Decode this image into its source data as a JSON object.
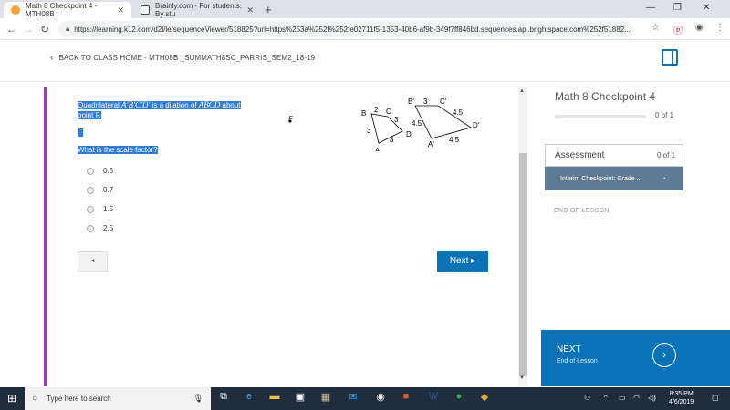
{
  "browser": {
    "tabs": [
      {
        "title": "Math 8 Checkpoint 4 - MTH08B",
        "active": true,
        "close": "✕"
      },
      {
        "title": "Brainly.com - For students. By stu",
        "active": false,
        "close": "✕"
      }
    ],
    "new_tab": "+",
    "url": "https://learning.k12.com/d2l/le/sequenceViewer/518825?url=https%253a%252f%252fe02711f5-1353-40b6-af9b-349f7ff846bd.sequences.api.brightspace.com%252f51882..."
  },
  "page_header": {
    "back_label": "BACK TO CLASS HOME - MTH08B _SUMMATH8SC_PARRIS_SEM2_18-19"
  },
  "question": {
    "line1_pre": "Quadrilateral ",
    "line1_math1": "A′B′C′D′",
    "line1_mid": " is a dilation of ",
    "line1_math2": "ABCD",
    "line1_post": " about",
    "line2": "point F.",
    "point_label": "F",
    "prompt": "What is the scale factor?",
    "options": [
      "0.5",
      "0.7",
      "1.5",
      "2.5"
    ]
  },
  "figure": {
    "small": {
      "vertices": [
        "B",
        "C",
        "D",
        "A"
      ],
      "sides": [
        "2",
        "3",
        "3",
        "3"
      ]
    },
    "large": {
      "vertices": [
        "B'",
        "C'",
        "D'",
        "A'"
      ],
      "sides": [
        "3",
        "4.5",
        "4.5",
        "4.5"
      ]
    }
  },
  "navigation": {
    "prev_label": "◂",
    "next_label": "Next ▸"
  },
  "sidebar": {
    "title": "Math 8 Checkpoint 4",
    "progress_fraction": 0,
    "progress_text": "0 of 1",
    "assessment_label": "Assessment",
    "assessment_count": "0 of 1",
    "activity_label": "Interim Checkpoint: Grade ...",
    "end_label": "END OF LESSON",
    "next_title": "NEXT",
    "next_subtitle": "End of Lesson",
    "next_arrow": "›"
  },
  "taskbar": {
    "search_placeholder": "Type here to search",
    "time": "8:35 PM",
    "date": "4/6/2019"
  },
  "colors": {
    "accent_blue": "#0a73b7",
    "lesson_bar_purple": "#9c3fb2",
    "selection_blue": "#2d7be5",
    "activity_bg": "#5f7c94"
  }
}
